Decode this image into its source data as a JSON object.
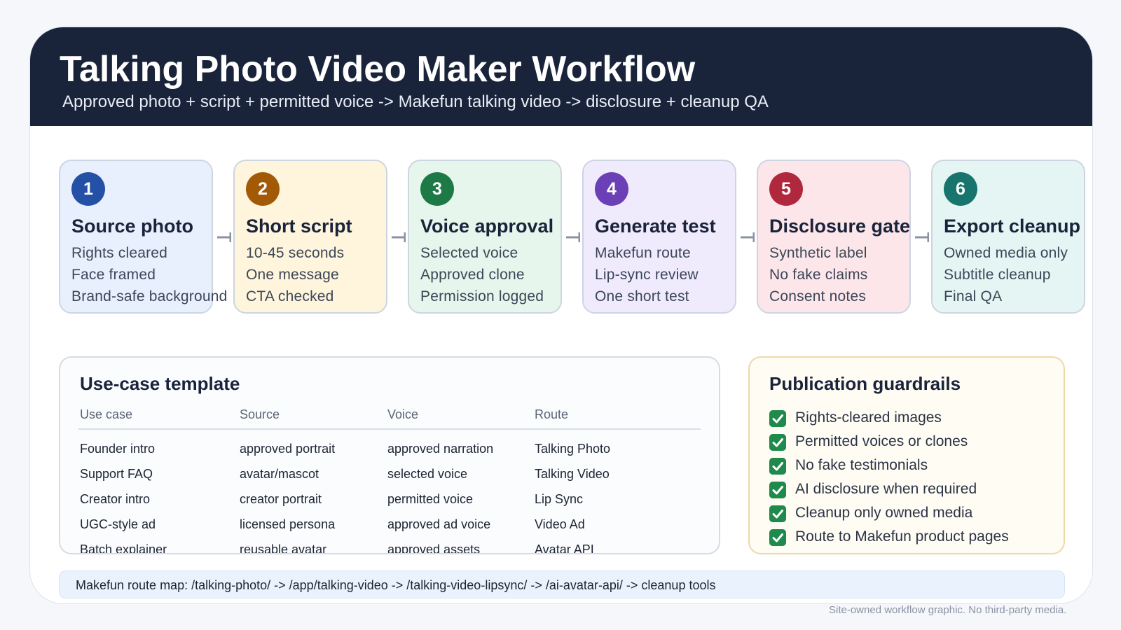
{
  "header": {
    "title": "Talking Photo Video Maker Workflow",
    "subtitle": "Approved photo + script + permitted voice -> Makefun talking video -> disclosure + cleanup QA"
  },
  "steps": [
    {
      "number": "1",
      "title": "Source photo",
      "items": [
        "Rights cleared",
        "Face framed",
        "Brand-safe background"
      ],
      "accent": "#2451a6",
      "bg": "#e8f0fd"
    },
    {
      "number": "2",
      "title": "Short script",
      "items": [
        "10-45 seconds",
        "One message",
        "CTA checked"
      ],
      "accent": "#a35a06",
      "bg": "#fff4dc"
    },
    {
      "number": "3",
      "title": "Voice approval",
      "items": [
        "Selected voice",
        "Approved clone",
        "Permission logged"
      ],
      "accent": "#1d7a47",
      "bg": "#e6f6ec"
    },
    {
      "number": "4",
      "title": "Generate test",
      "items": [
        "Makefun route",
        "Lip-sync review",
        "One short test"
      ],
      "accent": "#6b3fb5",
      "bg": "#f0eafd"
    },
    {
      "number": "5",
      "title": "Disclosure gate",
      "items": [
        "Synthetic label",
        "No fake claims",
        "Consent notes"
      ],
      "accent": "#b0283e",
      "bg": "#fde6ea"
    },
    {
      "number": "6",
      "title": "Export cleanup",
      "items": [
        "Owned media only",
        "Subtitle cleanup",
        "Final QA"
      ],
      "accent": "#17756d",
      "bg": "#e5f5f4"
    }
  ],
  "template": {
    "title": "Use-case template",
    "columns": [
      "Use case",
      "Source",
      "Voice",
      "Route"
    ],
    "rows": [
      [
        "Founder intro",
        "approved portrait",
        "approved narration",
        "Talking Photo"
      ],
      [
        "Support FAQ",
        "avatar/mascot",
        "selected voice",
        "Talking Video"
      ],
      [
        "Creator intro",
        "creator portrait",
        "permitted voice",
        "Lip Sync"
      ],
      [
        "UGC-style ad",
        "licensed persona",
        "approved ad voice",
        "Video Ad"
      ],
      [
        "Batch explainer",
        "reusable avatar",
        "approved assets",
        "Avatar API"
      ]
    ]
  },
  "guardrails": {
    "title": "Publication guardrails",
    "items": [
      "Rights-cleared images",
      "Permitted voices or clones",
      "No fake testimonials",
      "AI disclosure when required",
      "Cleanup only owned media",
      "Route to Makefun product pages"
    ]
  },
  "route_map": "Makefun route map: /talking-photo/ -> /app/talking-video -> /talking-video-lipsync/ -> /ai-avatar-api/ -> cleanup tools",
  "footnote": "Site-owned workflow graphic. No third-party media."
}
